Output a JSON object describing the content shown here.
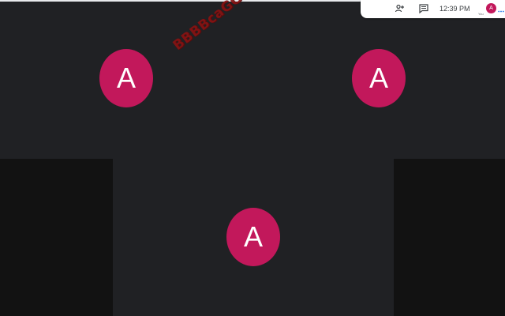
{
  "meeting": {
    "background_color": "#202124",
    "side_panel_color": "#121212",
    "avatar_color": "#c2185b",
    "watermark_text": "BBBBcaGG",
    "participants": [
      {
        "initial": "A"
      },
      {
        "initial": "A"
      },
      {
        "initial": "A"
      }
    ]
  },
  "topbar": {
    "people_icon": "people-icon",
    "chat_icon": "chat-icon",
    "time": "12:39  PM",
    "self_initial": "A",
    "self_label": "You",
    "accent_color": "#1a73e8"
  }
}
